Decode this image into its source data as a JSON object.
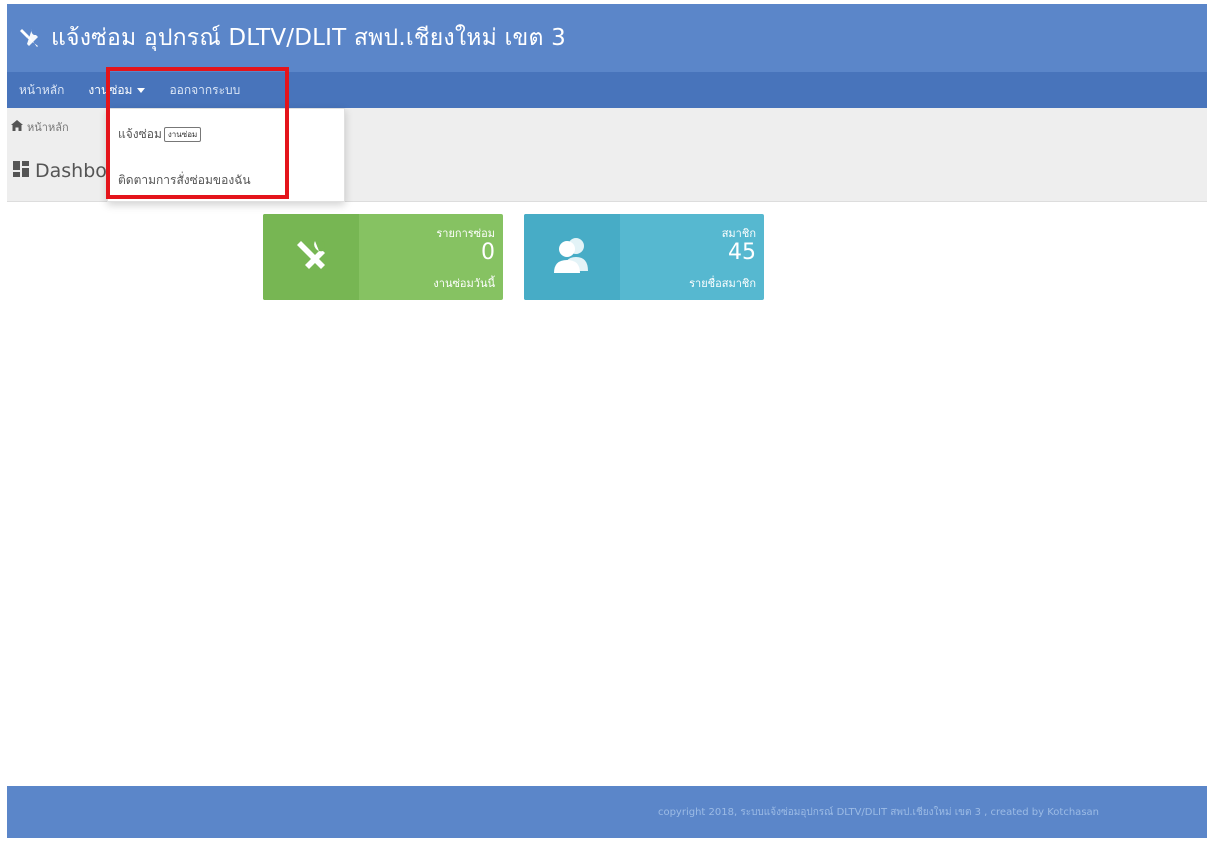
{
  "header": {
    "title": "แจ้งซ่อม อุปกรณ์ DLTV/DLIT สพป.เชียงใหม่ เขต 3",
    "icon": "tools-icon",
    "color": "#5b86c9"
  },
  "navbar": {
    "items": [
      {
        "label": "หน้าหลัก"
      },
      {
        "label": "งานซ่อม"
      },
      {
        "label": "ออกจากระบบ"
      }
    ],
    "color": "#4874bb"
  },
  "dropdown": {
    "items": [
      {
        "label": "แจ้งซ่อม",
        "tooltip": "งานซ่อม"
      },
      {
        "label": "ติดตามการสั่งซ่อมของฉัน"
      }
    ]
  },
  "breadcrumb": {
    "home_label": "หน้าหลัก",
    "icon": "home-icon"
  },
  "page": {
    "title": "Dashboard",
    "icon": "dashboard-icon"
  },
  "cards": [
    {
      "top_label": "รายการซ่อม",
      "value": "0",
      "bottom_label": "งานซ่อมวันนี้",
      "icon": "tools-icon",
      "color": "#86c262"
    },
    {
      "top_label": "สมาชิก",
      "value": "45",
      "bottom_label": "รายชื่อสมาชิก",
      "icon": "users-icon",
      "color": "#56b8d0"
    }
  ],
  "footer": {
    "text": "copyright 2018, ระบบแจ้งซ่อมอุปกรณ์ DLTV/DLIT สพป.เชียงใหม่ เขต 3 , created by Kotchasan"
  },
  "annotation": {
    "highlight_color": "#e4141b"
  }
}
